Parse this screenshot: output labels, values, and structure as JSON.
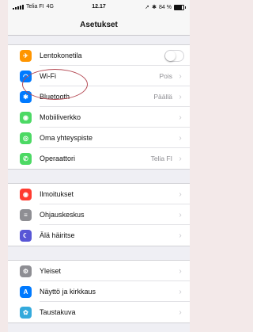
{
  "status_bar": {
    "carrier": "Telia FI",
    "network": "4G",
    "time": "12.17",
    "icons": "location-icon bluetooth-icon",
    "battery_text": "84 %",
    "battery_level": 0.84
  },
  "nav": {
    "title": "Asetukset"
  },
  "groups": [
    {
      "rows": [
        {
          "label": "Lentokonetila",
          "icon": "airplane-icon",
          "color": "#ff9500",
          "control": "toggle",
          "toggle_on": false
        },
        {
          "label": "Wi-Fi",
          "icon": "wifi-icon",
          "color": "#007aff",
          "value": "Pois"
        },
        {
          "label": "Bluetooth",
          "icon": "bluetooth-icon",
          "color": "#007aff",
          "value": "Päällä"
        },
        {
          "label": "Mobiiliverkko",
          "icon": "cellular-icon",
          "color": "#4cd964"
        },
        {
          "label": "Oma yhteyspiste",
          "icon": "hotspot-icon",
          "color": "#4cd964"
        },
        {
          "label": "Operaattori",
          "icon": "phone-icon",
          "color": "#4cd964",
          "value": "Telia FI"
        }
      ]
    },
    {
      "rows": [
        {
          "label": "Ilmoitukset",
          "icon": "notifications-icon",
          "color": "#ff3b30"
        },
        {
          "label": "Ohjauskeskus",
          "icon": "control-center-icon",
          "color": "#8e8e93"
        },
        {
          "label": "Älä häiritse",
          "icon": "moon-icon",
          "color": "#5856d6"
        }
      ]
    },
    {
      "rows": [
        {
          "label": "Yleiset",
          "icon": "gear-icon",
          "color": "#8e8e93"
        },
        {
          "label": "Näyttö ja kirkkaus",
          "icon": "display-icon",
          "color": "#007aff"
        },
        {
          "label": "Taustakuva",
          "icon": "wallpaper-icon",
          "color": "#34aadc"
        }
      ]
    }
  ],
  "annotation": {
    "color": "#b54b55"
  }
}
